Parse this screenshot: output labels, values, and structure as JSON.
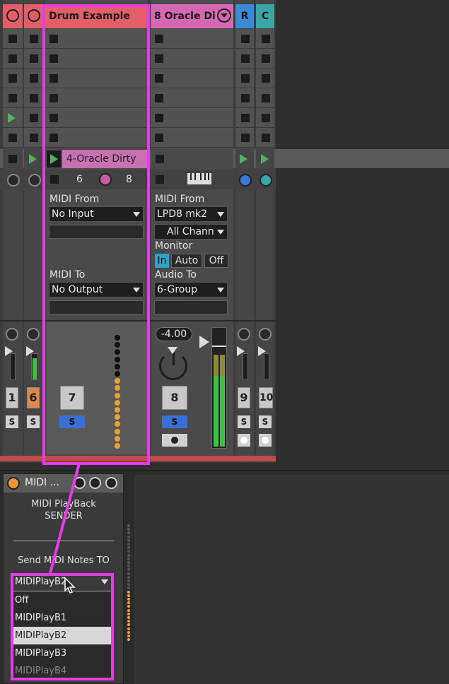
{
  "tracks": {
    "drum": {
      "title": "Drum Example",
      "num_left": "6",
      "num_right": "8",
      "number": "7",
      "midi_from_label": "MIDI From",
      "midi_from_value": "No Input",
      "midi_to_label": "MIDI To",
      "midi_to_value": "No Output"
    },
    "oracle": {
      "title": "8 Oracle Di",
      "midi_from_label": "MIDI From",
      "midi_from_value": "LPD8 mk2",
      "channel_value": "All Chann",
      "monitor_label": "Monitor",
      "monitor_in": "In",
      "monitor_auto": "Auto",
      "monitor_off": "Off",
      "audio_to_label": "Audio To",
      "audio_to_value": "6-Group",
      "volume": "-4.00",
      "number": "8"
    },
    "return_r": {
      "title": "R",
      "number": "9"
    },
    "return_c": {
      "title": "C",
      "number": "10"
    },
    "track1": {
      "number": "1"
    },
    "track6": {
      "number": "6"
    }
  },
  "clip": {
    "name": "4-Oracle Dirty"
  },
  "solo_label": "S",
  "device": {
    "title": "MIDI ...",
    "line1": "MIDI PlayBack",
    "line2": "SENDER",
    "send_label": "Send MIDI Notes TO",
    "selected": "MIDIPlayB2",
    "options": [
      "Off",
      "MIDIPlayB1",
      "MIDIPlayB2",
      "MIDIPlayB3",
      "MIDIPlayB4"
    ]
  },
  "colors": {
    "drum_header": "#e25f6a",
    "oracle_header": "#d568b0",
    "return_r": "#3a8ad6",
    "return_c": "#3aa6a6",
    "highlight": "#e23ee6",
    "meter_orange": "#e8a13a",
    "meter_green": "#3fbf4a"
  }
}
